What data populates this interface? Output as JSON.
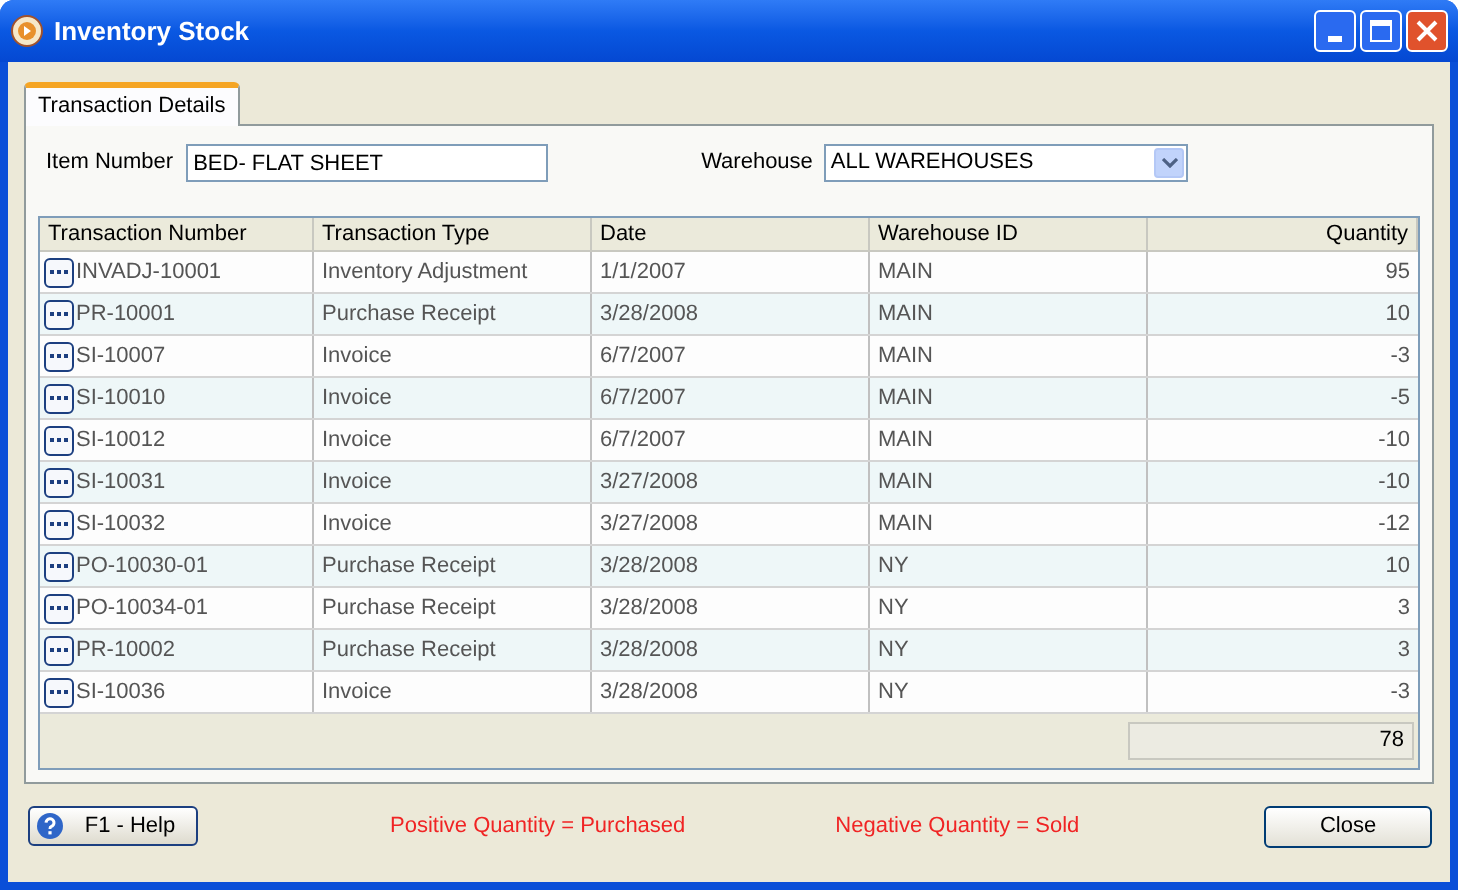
{
  "window": {
    "title": "Inventory Stock"
  },
  "tabs": [
    {
      "label": "Transaction Details",
      "selected": true
    }
  ],
  "item_number": {
    "label": "Item Number",
    "value": "BED- FLAT SHEET"
  },
  "warehouse": {
    "label": "Warehouse",
    "value": "ALL WAREHOUSES"
  },
  "table": {
    "columns": [
      "Transaction Number",
      "Transaction Type",
      "Date",
      "Warehouse ID",
      "Quantity"
    ],
    "rows": [
      {
        "number": "INVADJ-10001",
        "type": "Inventory Adjustment",
        "date": "1/1/2007",
        "warehouse": "MAIN",
        "quantity": "95"
      },
      {
        "number": "PR-10001",
        "type": "Purchase Receipt",
        "date": "3/28/2008",
        "warehouse": "MAIN",
        "quantity": "10"
      },
      {
        "number": "SI-10007",
        "type": "Invoice",
        "date": "6/7/2007",
        "warehouse": "MAIN",
        "quantity": "-3"
      },
      {
        "number": "SI-10010",
        "type": "Invoice",
        "date": "6/7/2007",
        "warehouse": "MAIN",
        "quantity": "-5"
      },
      {
        "number": "SI-10012",
        "type": "Invoice",
        "date": "6/7/2007",
        "warehouse": "MAIN",
        "quantity": "-10"
      },
      {
        "number": "SI-10031",
        "type": "Invoice",
        "date": "3/27/2008",
        "warehouse": "MAIN",
        "quantity": "-10"
      },
      {
        "number": "SI-10032",
        "type": "Invoice",
        "date": "3/27/2008",
        "warehouse": "MAIN",
        "quantity": "-12"
      },
      {
        "number": "PO-10030-01",
        "type": "Purchase Receipt",
        "date": "3/28/2008",
        "warehouse": "NY",
        "quantity": "10"
      },
      {
        "number": "PO-10034-01",
        "type": "Purchase Receipt",
        "date": "3/28/2008",
        "warehouse": "NY",
        "quantity": "3"
      },
      {
        "number": "PR-10002",
        "type": "Purchase Receipt",
        "date": "3/28/2008",
        "warehouse": "NY",
        "quantity": "3"
      },
      {
        "number": "SI-10036",
        "type": "Invoice",
        "date": "3/28/2008",
        "warehouse": "NY",
        "quantity": "-3"
      }
    ],
    "total": "78"
  },
  "help_button": {
    "label": "F1 - Help"
  },
  "legend": [
    "Positive Quantity = Purchased",
    "Negative Quantity = Sold"
  ],
  "close_button": {
    "label": "Close"
  }
}
